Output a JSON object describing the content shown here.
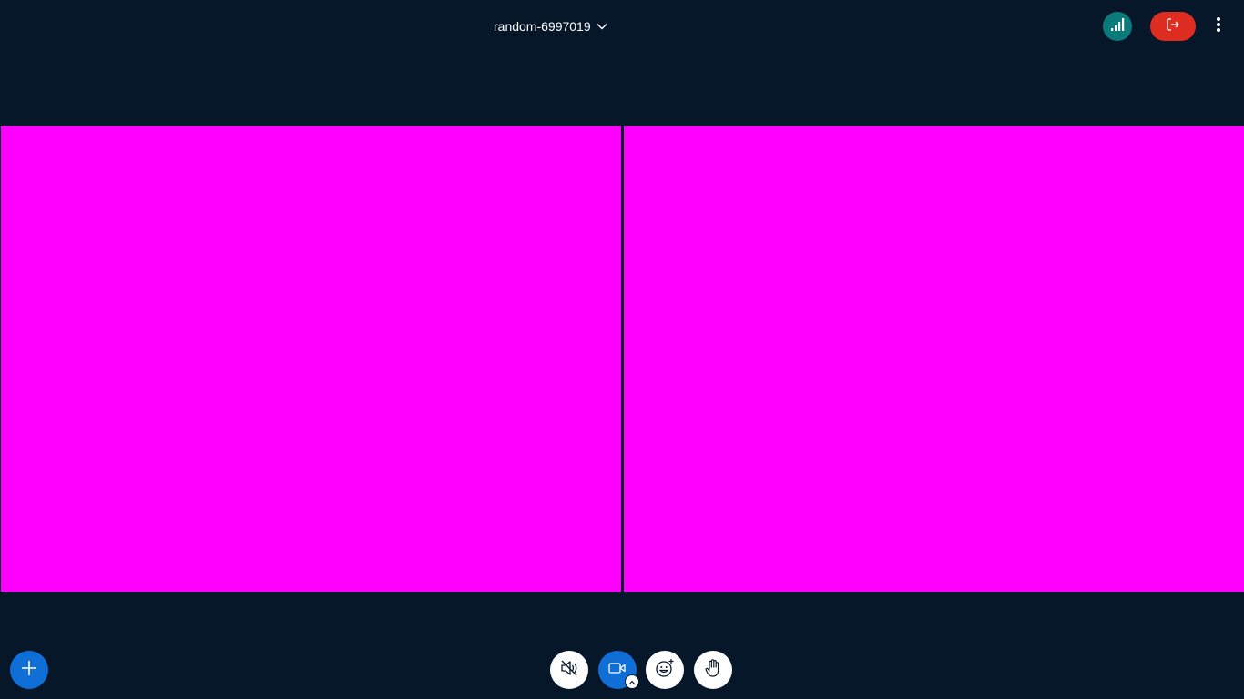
{
  "header": {
    "meeting_name": "random-6997019",
    "icons": {
      "dropdown": "chevron-down-icon",
      "connection": "signal-bars-icon",
      "leave": "leave-icon",
      "more": "more-vertical-icon"
    }
  },
  "colors": {
    "background": "#06172a",
    "tile": "#ff00ff",
    "primary": "#0f6fd6",
    "danger": "#df2d22",
    "connection": "#0b7a7a"
  },
  "videos": {
    "tiles": [
      "participant-video-1",
      "participant-video-2"
    ]
  },
  "controls": {
    "icons": [
      "speaker-icon",
      "camera-icon",
      "emoji-icon",
      "hand-icon",
      "plus-icon"
    ]
  }
}
